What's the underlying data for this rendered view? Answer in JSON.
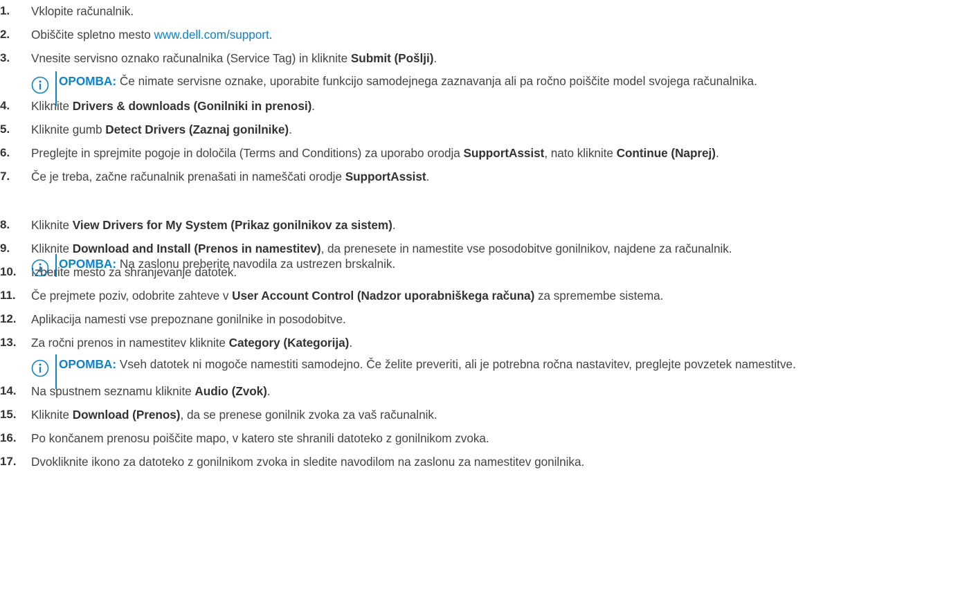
{
  "note_label": "OPOMBA:",
  "steps": [
    {
      "num": "1.",
      "parts": [
        {
          "t": "Vklopite računalnik."
        }
      ]
    },
    {
      "num": "2.",
      "parts": [
        {
          "t": "Obiščite spletno mesto "
        },
        {
          "t": "www.dell.com/support",
          "link": true
        },
        {
          "t": "."
        }
      ]
    },
    {
      "num": "3.",
      "parts": [
        {
          "t": "Vnesite servisno oznako računalnika (Service Tag) in kliknite "
        },
        {
          "t": "Submit (Pošlji)",
          "b": true
        },
        {
          "t": "."
        }
      ]
    },
    {
      "num": "4.",
      "parts": [
        {
          "t": "Kliknite "
        },
        {
          "t": "Drivers & downloads (Gonilniki in prenosi)",
          "b": true
        },
        {
          "t": "."
        }
      ]
    },
    {
      "num": "5.",
      "parts": [
        {
          "t": "Kliknite gumb "
        },
        {
          "t": "Detect Drivers (Zaznaj gonilnike)",
          "b": true
        },
        {
          "t": "."
        }
      ]
    },
    {
      "num": "6.",
      "parts": [
        {
          "t": "Preglejte in sprejmite pogoje in določila (Terms and Conditions) za uporabo orodja "
        },
        {
          "t": "SupportAssist",
          "b": true
        },
        {
          "t": ", nato kliknite "
        },
        {
          "t": "Continue (Naprej)",
          "b": true
        },
        {
          "t": "."
        }
      ]
    },
    {
      "num": "7.",
      "parts": [
        {
          "t": "Če je treba, začne računalnik prenašati in nameščati orodje "
        },
        {
          "t": "SupportAssist",
          "b": true
        },
        {
          "t": "."
        }
      ]
    },
    {
      "num": "8.",
      "parts": [
        {
          "t": "Kliknite "
        },
        {
          "t": "View Drivers for My System (Prikaz gonilnikov za sistem)",
          "b": true
        },
        {
          "t": "."
        }
      ]
    },
    {
      "num": "9.",
      "parts": [
        {
          "t": "Kliknite "
        },
        {
          "t": "Download and Install (Prenos in namestitev)",
          "b": true
        },
        {
          "t": ", da prenesete in namestite vse posodobitve gonilnikov, najdene za računalnik."
        }
      ]
    },
    {
      "num": "10.",
      "parts": [
        {
          "t": "Izberite mesto za shranjevanje datotek."
        }
      ]
    },
    {
      "num": "11.",
      "parts": [
        {
          "t": "Če prejmete poziv, odobrite zahteve v "
        },
        {
          "t": "User Account Control (Nadzor uporabniškega računa)",
          "b": true
        },
        {
          "t": " za spremembe sistema."
        }
      ]
    },
    {
      "num": "12.",
      "parts": [
        {
          "t": "Aplikacija namesti vse prepoznane gonilnike in posodobitve."
        }
      ]
    },
    {
      "num": "13.",
      "parts": [
        {
          "t": "Za ročni prenos in namestitev kliknite "
        },
        {
          "t": "Category (Kategorija)",
          "b": true
        },
        {
          "t": "."
        }
      ]
    },
    {
      "num": "14.",
      "parts": [
        {
          "t": "Na spustnem seznamu kliknite "
        },
        {
          "t": "Audio (Zvok)",
          "b": true
        },
        {
          "t": "."
        }
      ]
    },
    {
      "num": "15.",
      "parts": [
        {
          "t": "Kliknite "
        },
        {
          "t": "Download (Prenos)",
          "b": true
        },
        {
          "t": ", da se prenese gonilnik zvoka za vaš računalnik."
        }
      ]
    },
    {
      "num": "16.",
      "parts": [
        {
          "t": "Po končanem prenosu poiščite mapo, v katero ste shranili datoteko z gonilnikom zvoka."
        }
      ]
    },
    {
      "num": "17.",
      "parts": [
        {
          "t": "Dvokliknite ikono za datoteko z gonilnikom zvoka in sledite navodilom na zaslonu za namestitev gonilnika."
        }
      ]
    }
  ],
  "notes": [
    {
      "after_step": "3.",
      "text": "Če nimate servisne oznake, uporabite funkcijo samodejnega zaznavanja ali pa ročno poiščite model svojega računalnika."
    },
    {
      "after_step": "7.",
      "text": "Na zaslonu preberite navodila za ustrezen brskalnik."
    },
    {
      "after_step": "12.",
      "text": "Vseh datotek ni mogoče namestiti samodejno. Če želite preveriti, ali je potrebna ročna nastavitev, preglejte povzetek namestitve."
    }
  ]
}
